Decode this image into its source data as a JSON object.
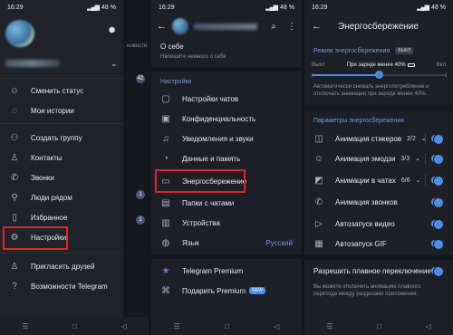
{
  "status": {
    "time": "16:29",
    "battery": "48 %"
  },
  "panel1": {
    "menu": [
      {
        "label": "Сменить статус",
        "icon": "emoji-status-icon"
      },
      {
        "label": "Мои истории",
        "icon": "stories-icon"
      },
      {
        "label": "Создать группу",
        "icon": "group-icon"
      },
      {
        "label": "Контакты",
        "icon": "contacts-icon"
      },
      {
        "label": "Звонки",
        "icon": "phone-icon"
      },
      {
        "label": "Люди рядом",
        "icon": "people-nearby-icon"
      },
      {
        "label": "Избранное",
        "icon": "bookmark-icon"
      },
      {
        "label": "Настройки",
        "icon": "gear-icon"
      },
      {
        "label": "Пригласить друзей",
        "icon": "add-user-icon"
      },
      {
        "label": "Возможности Telegram",
        "icon": "question-icon"
      }
    ],
    "strip": {
      "label": "новости",
      "badges": [
        "42",
        "",
        "",
        "",
        "1",
        "1"
      ],
      "times": [
        "",
        "",
        "",
        ""
      ]
    }
  },
  "panel2": {
    "about_title": "О себе",
    "about_sub": "Напишите немного о себе",
    "section": "Настройки",
    "items": [
      {
        "label": "Настройки чатов",
        "icon": "chat-icon"
      },
      {
        "label": "Конфиденциальность",
        "icon": "lock-icon"
      },
      {
        "label": "Уведомления и звуки",
        "icon": "bell-icon"
      },
      {
        "label": "Данные и память",
        "icon": "storage-icon"
      },
      {
        "label": "Энергосбережение",
        "icon": "battery-icon"
      },
      {
        "label": "Папки с чатами",
        "icon": "folder-icon"
      },
      {
        "label": "Устройства",
        "icon": "devices-icon"
      },
      {
        "label": "Язык",
        "icon": "globe-icon",
        "value": "Русский"
      }
    ],
    "premium": "Telegram Premium",
    "gift": "Подарить Premium",
    "new_badge": "NEW"
  },
  "panel3": {
    "title": "Энергосбережение",
    "mode_label": "Режим энергосбережения",
    "mode_state": "ВЫКЛ",
    "slider_left": "Выкл",
    "slider_mid": "При заряде менее 40%",
    "slider_right": "Вкл",
    "slider_level": 0.5,
    "desc1": "Автоматически снижать энергопотребление и отключать анимации при заряде менее 40%.",
    "section": "Параметры энергосбережения",
    "items": [
      {
        "label": "Анимация стикеров",
        "count": "2/2",
        "icon": "sticker-icon"
      },
      {
        "label": "Анимация эмодзи",
        "count": "3/3",
        "icon": "emoji-icon"
      },
      {
        "label": "Анимации в чатах",
        "count": "6/6",
        "icon": "chat-animation-icon"
      },
      {
        "label": "Анимация звонков",
        "count": "",
        "icon": "call-animation-icon"
      },
      {
        "label": "Автозапуск видео",
        "count": "",
        "icon": "video-icon"
      },
      {
        "label": "Автозапуск GIF",
        "count": "",
        "icon": "gif-icon"
      }
    ],
    "smooth": "Разрешить плавное переключение",
    "desc2": "Вы можете отключить анимацию плавного перехода между разделами приложения."
  }
}
